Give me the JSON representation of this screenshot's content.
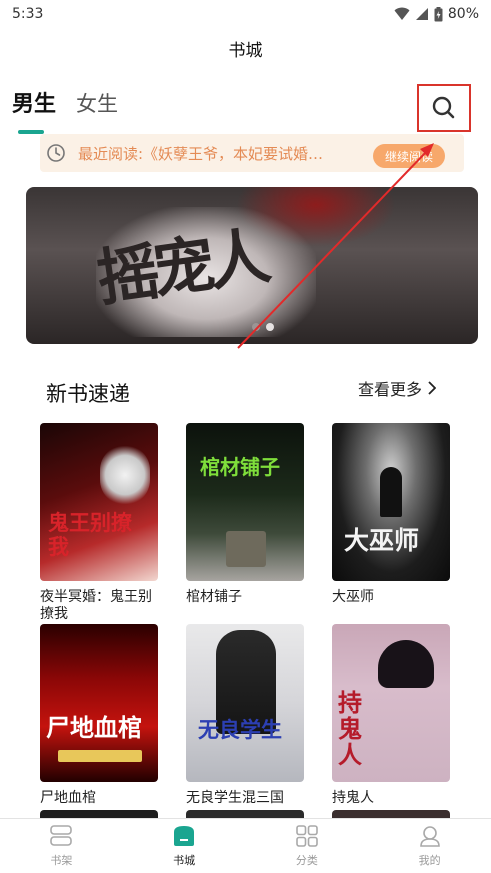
{
  "status_bar": {
    "time": "5:33",
    "battery": "80%"
  },
  "header": {
    "title": "书城"
  },
  "tabs": [
    {
      "label": "男生"
    },
    {
      "label": "女生"
    }
  ],
  "recent": {
    "text": "最近阅读:《妖孽王爷，本妃要试婚…",
    "button": "继续阅读"
  },
  "banner": {
    "cover_text": "摇宠人",
    "slide_count": 2,
    "active_slide": 2
  },
  "new_books": {
    "title": "新书速递",
    "more": "查看更多",
    "books": [
      {
        "title": "夜半冥婚：鬼王别撩我",
        "cover_text": "鬼王别撩我"
      },
      {
        "title": "棺材铺子",
        "cover_text": "棺材铺子"
      },
      {
        "title": "大巫师",
        "cover_text": "大巫师"
      },
      {
        "title": "尸地血棺",
        "cover_text": "尸地血棺"
      },
      {
        "title": "无良学生混三国",
        "cover_text": "无良学生"
      },
      {
        "title": "持鬼人",
        "cover_text": "持鬼人"
      }
    ]
  },
  "bottom_nav": [
    {
      "label": "书架",
      "icon": "bookshelf-icon"
    },
    {
      "label": "书城",
      "icon": "bookstore-icon"
    },
    {
      "label": "分类",
      "icon": "category-icon"
    },
    {
      "label": "我的",
      "icon": "profile-icon"
    }
  ],
  "colors": {
    "accent": "#1aa590",
    "recent_text": "#e48b55",
    "continue_button": "#f7a86b",
    "highlight_box": "#d9342b"
  }
}
